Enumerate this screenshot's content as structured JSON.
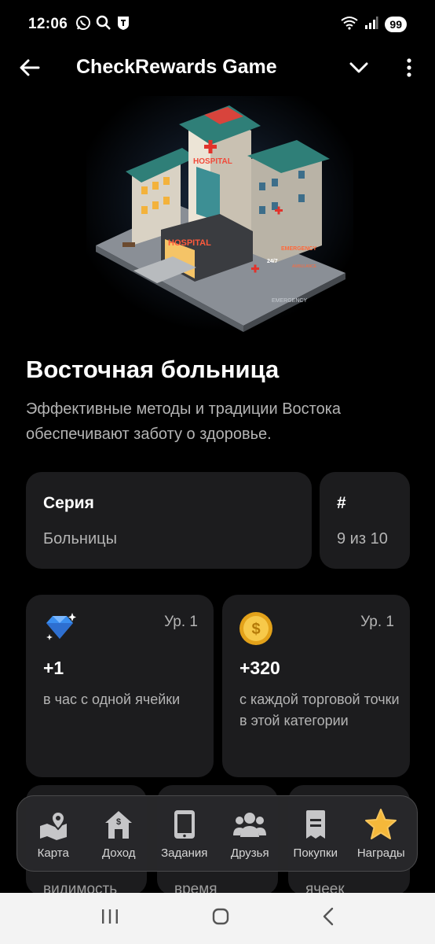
{
  "status": {
    "time": "12:06",
    "battery": "99"
  },
  "header": {
    "title": "CheckRewards Game"
  },
  "building": {
    "sign_top": "HOSPITAL",
    "sign_bottom": "HOSPITAL",
    "sign_side": "EMERGENCY",
    "sign_247": "24/7",
    "sign_ambulance": "AMBULANCE",
    "sign_ground": "EMERGENCY",
    "name": "Восточная больница",
    "description": "Эффективные методы и традиции Востока обеспечивают заботу о здоровье."
  },
  "series_card": {
    "label": "Серия",
    "value": "Больницы"
  },
  "number_card": {
    "label": "#",
    "value": "9 из 10"
  },
  "rewards": [
    {
      "icon": "diamond-icon",
      "level": "Ур. 1",
      "amount": "+1",
      "note": "в час с одной ячейки"
    },
    {
      "icon": "coin-icon",
      "level": "Ур. 1",
      "amount": "+320",
      "note": "с каждой торговой точки в этой категории"
    }
  ],
  "peek_texts": [
    "видимость",
    "время",
    "ячеек"
  ],
  "nav": [
    {
      "icon": "map-icon",
      "label": "Карта"
    },
    {
      "icon": "income-house-icon",
      "label": "Доход"
    },
    {
      "icon": "tablet-icon",
      "label": "Задания"
    },
    {
      "icon": "friends-icon",
      "label": "Друзья"
    },
    {
      "icon": "receipt-icon",
      "label": "Покупки"
    },
    {
      "icon": "star-icon",
      "label": "Награды"
    }
  ],
  "colors": {
    "background": "#000000",
    "card": "#1c1c1e",
    "muted_text": "#b4b4b4",
    "star": "#f5b83a",
    "coin": "#f0b52a",
    "diamond": "#3a8ef0"
  }
}
